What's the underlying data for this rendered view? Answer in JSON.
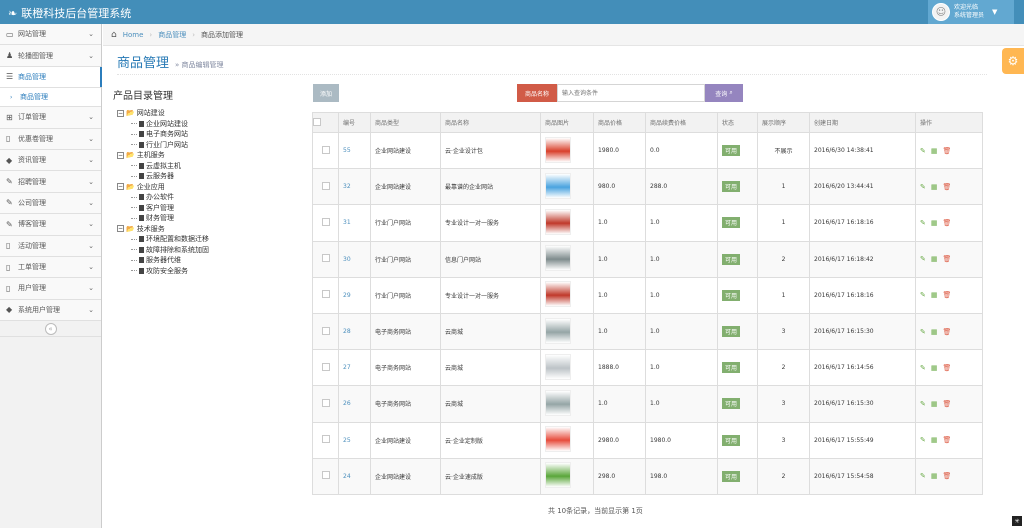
{
  "app": {
    "title": "联橙科技后台管理系统"
  },
  "user": {
    "welcome": "欢迎光临",
    "role": "系统管理员"
  },
  "sidebar": {
    "items": [
      {
        "label": "网站管理",
        "icon": "monitor-icon"
      },
      {
        "label": "轮播图管理",
        "icon": "users-icon"
      },
      {
        "label": "商品管理",
        "icon": "list-icon",
        "active": true
      },
      {
        "label": "订单管理",
        "icon": "cart-icon"
      },
      {
        "label": "优惠卷管理",
        "icon": "file-icon"
      },
      {
        "label": "资讯管理",
        "icon": "tag-icon"
      },
      {
        "label": "招聘管理",
        "icon": "edit-icon"
      },
      {
        "label": "公司管理",
        "icon": "edit-icon"
      },
      {
        "label": "博客管理",
        "icon": "edit-icon"
      },
      {
        "label": "活动管理",
        "icon": "file-icon"
      },
      {
        "label": "工单管理",
        "icon": "file-icon"
      },
      {
        "label": "用户管理",
        "icon": "file-icon"
      },
      {
        "label": "系统用户管理",
        "icon": "tag-icon"
      }
    ],
    "sub_item": "商品管理"
  },
  "breadcrumb": {
    "home": "Home",
    "level1": "商品管理",
    "level2": "商品添加管理"
  },
  "page": {
    "title": "商品管理",
    "subtitle": "» 商品编辑管理"
  },
  "tree": {
    "title": "产品目录管理",
    "groups": [
      {
        "label": "网站建设",
        "children": [
          "企业网站建设",
          "电子商务网站",
          "行业门户网站"
        ]
      },
      {
        "label": "主机服务",
        "children": [
          "云虚拟主机",
          "云服务器"
        ]
      },
      {
        "label": "企业应用",
        "children": [
          "办公软件",
          "客户管理",
          "财务管理"
        ]
      },
      {
        "label": "技术服务",
        "children": [
          "环境配置和数据迁移",
          "故障排除和系统加固",
          "服务器代维",
          "攻防安全服务"
        ]
      }
    ]
  },
  "toolbar": {
    "add_label": "添加",
    "search_label": "商品名称",
    "search_placeholder": "输入查询条件",
    "search_button": "查询"
  },
  "table": {
    "headers": [
      "编号",
      "商品类型",
      "商品名称",
      "商品图片",
      "商品价格",
      "商品续费价格",
      "状态",
      "展示顺序",
      "创建日期",
      "操作"
    ],
    "rows": [
      {
        "id": "55",
        "type": "企业网站建设",
        "name": "云·企业设计包",
        "price": "1980.0",
        "renew": "0.0",
        "status": "可用",
        "order": "不展示",
        "date": "2016/6/30 14:38:41",
        "thumb": "#d9402b"
      },
      {
        "id": "32",
        "type": "企业网站建设",
        "name": "最靠谱的企业网站",
        "price": "980.0",
        "renew": "288.0",
        "status": "可用",
        "order": "1",
        "date": "2016/6/20 13:44:41",
        "thumb": "#4aa3df"
      },
      {
        "id": "31",
        "type": "行业门户网站",
        "name": "专业设计一对一服务",
        "price": "1.0",
        "renew": "1.0",
        "status": "可用",
        "order": "1",
        "date": "2016/6/17 16:18:16",
        "thumb": "#c0392b"
      },
      {
        "id": "30",
        "type": "行业门户网站",
        "name": "信息门户网站",
        "price": "1.0",
        "renew": "1.0",
        "status": "可用",
        "order": "2",
        "date": "2016/6/17 16:18:42",
        "thumb": "#7f8c8d"
      },
      {
        "id": "29",
        "type": "行业门户网站",
        "name": "专业设计一对一服务",
        "price": "1.0",
        "renew": "1.0",
        "status": "可用",
        "order": "1",
        "date": "2016/6/17 16:18:16",
        "thumb": "#c0392b"
      },
      {
        "id": "28",
        "type": "电子商务网站",
        "name": "云商城",
        "price": "1.0",
        "renew": "1.0",
        "status": "可用",
        "order": "3",
        "date": "2016/6/17 16:15:30",
        "thumb": "#95a5a6"
      },
      {
        "id": "27",
        "type": "电子商务网站",
        "name": "云商城",
        "price": "1888.0",
        "renew": "1.0",
        "status": "可用",
        "order": "2",
        "date": "2016/6/17 16:14:56",
        "thumb": "#bdc3c7"
      },
      {
        "id": "26",
        "type": "电子商务网站",
        "name": "云商城",
        "price": "1.0",
        "renew": "1.0",
        "status": "可用",
        "order": "3",
        "date": "2016/6/17 16:15:30",
        "thumb": "#95a5a6"
      },
      {
        "id": "25",
        "type": "企业网站建设",
        "name": "云·企业定制版",
        "price": "2980.0",
        "renew": "1980.0",
        "status": "可用",
        "order": "3",
        "date": "2016/6/17 15:55:49",
        "thumb": "#e74c3c"
      },
      {
        "id": "24",
        "type": "企业网站建设",
        "name": "云·企业速成版",
        "price": "298.0",
        "renew": "198.0",
        "status": "可用",
        "order": "2",
        "date": "2016/6/17 15:54:58",
        "thumb": "#5aa63a"
      }
    ]
  },
  "pager": {
    "info": "共 10条记录，当前显示第 1页"
  },
  "colors": {
    "topbar": "#438eb9",
    "accent": "#2679b5",
    "status_ok": "#82af6f",
    "danger": "#d15b47",
    "search": "#9585bf",
    "settings": "#ffb752"
  }
}
